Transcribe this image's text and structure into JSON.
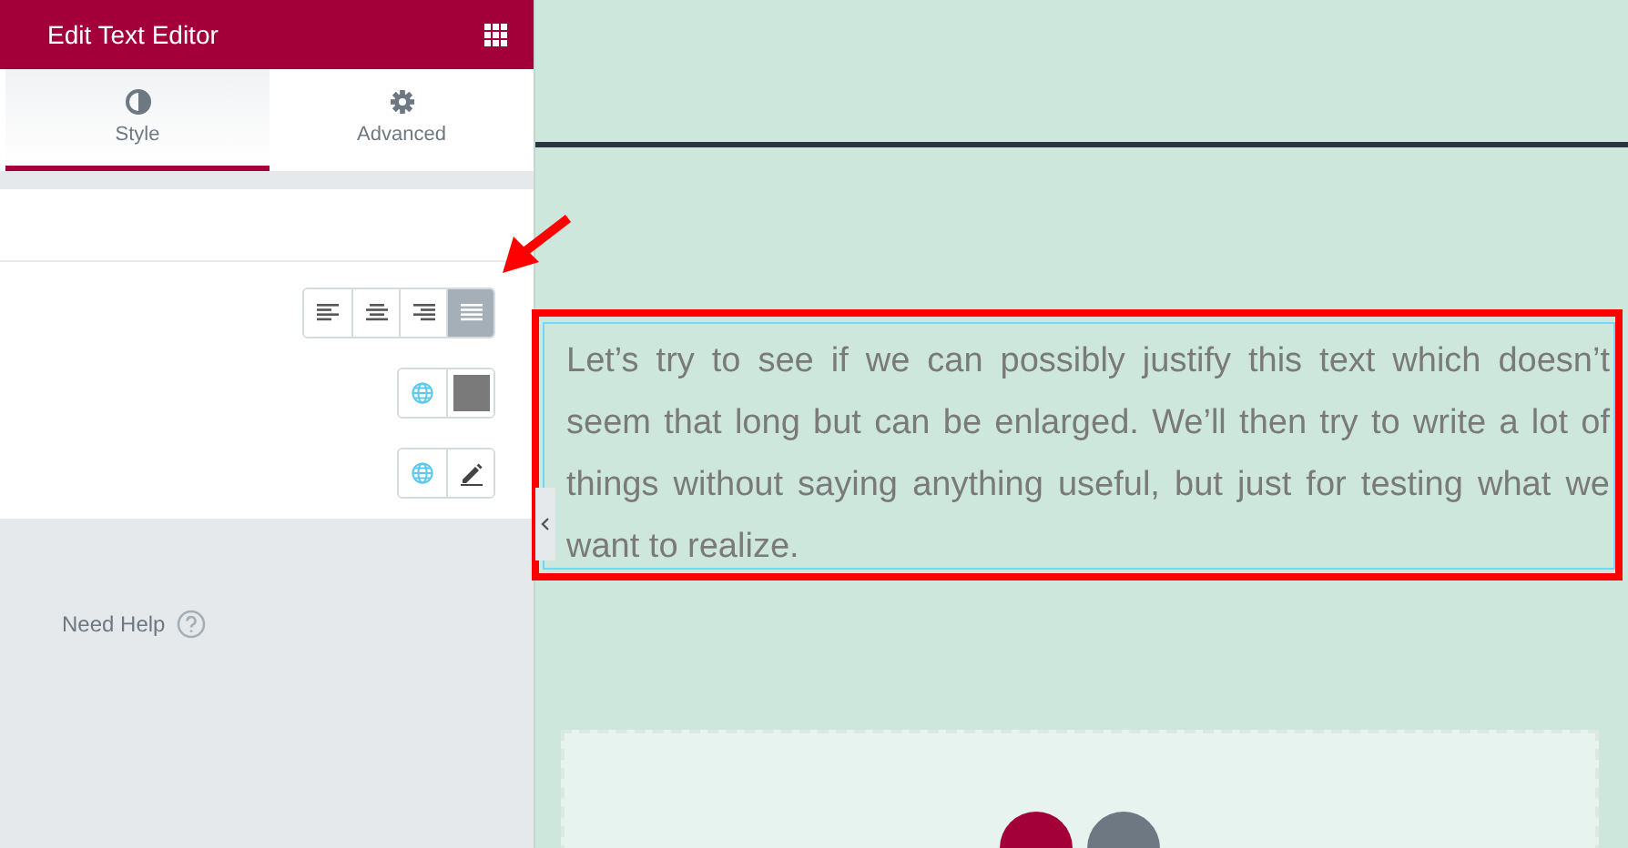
{
  "panel": {
    "title": "Edit Text Editor"
  },
  "tabs": [
    {
      "label": "Style",
      "selected": true,
      "kind": "style"
    },
    {
      "label": "Advanced",
      "selected": false,
      "kind": "advanced"
    }
  ],
  "alignment": [
    {
      "kind": "left",
      "selected": false
    },
    {
      "kind": "center",
      "selected": false
    },
    {
      "kind": "right",
      "selected": false
    },
    {
      "kind": "justify",
      "selected": true
    }
  ],
  "color_row": {
    "color": "#7a7a7a"
  },
  "help": {
    "label": "Need Help"
  },
  "canvas": {
    "paragraph": "Let’s try to see if we can possibly justify this text which doesn’t seem that long but can be enlarged. We’ll then try to write a lot of things without saying anything useful, but just for testing what we want to realize."
  }
}
